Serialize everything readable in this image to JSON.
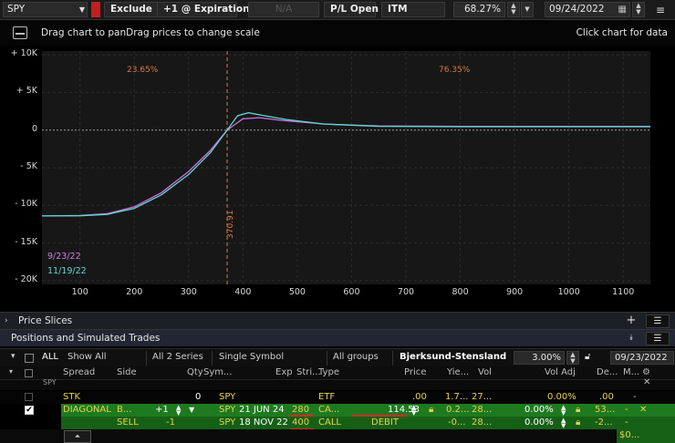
{
  "toolbar": {
    "symbol": "SPY",
    "exclude_label": "Exclude",
    "expiration_label": "+1 @ Expiration",
    "na_value": "N/A",
    "pl_label": "P/L Open",
    "itm_label": "ITM",
    "pct_value": "68.27%",
    "date_value": "09/24/2022"
  },
  "chart_header": {
    "hint": "Drag chart to panDrag prices to change scale",
    "click_hint": "Click chart for data"
  },
  "chart_data": {
    "type": "line",
    "y_ticks": [
      "+ 10K",
      "+ 5K",
      "0",
      "- 5K",
      "- 10K",
      "- 15K",
      "- 20K"
    ],
    "y_values": [
      10000,
      5000,
      0,
      -5000,
      -10000,
      -15000,
      -20000
    ],
    "x_ticks": [
      "100",
      "200",
      "300",
      "400",
      "500",
      "600",
      "700",
      "800",
      "900",
      "1000",
      "1100"
    ],
    "x_values": [
      100,
      200,
      300,
      400,
      500,
      600,
      700,
      800,
      900,
      1000,
      1100
    ],
    "xlim": [
      30,
      1150
    ],
    "ylim": [
      -20500,
      10500
    ],
    "vline_price": "370.91",
    "vline_x": 370.91,
    "prob_left": "23.65%",
    "prob_right": "76.35%",
    "series": [
      {
        "name": "9/23/22",
        "color": "#c86fe0",
        "x": [
          30,
          100,
          150,
          200,
          250,
          300,
          340,
          370.91,
          400,
          430,
          470,
          550,
          650,
          800,
          1000,
          1150
        ],
        "y": [
          -11400,
          -11350,
          -11100,
          -10200,
          -8300,
          -5500,
          -2700,
          0,
          1500,
          1650,
          1300,
          800,
          550,
          500,
          500,
          500
        ]
      },
      {
        "name": "11/19/22",
        "color": "#5fd7d0",
        "x": [
          30,
          100,
          150,
          200,
          250,
          300,
          340,
          370.91,
          390,
          410,
          440,
          480,
          550,
          650,
          800,
          1000,
          1150
        ],
        "y": [
          -11400,
          -11380,
          -11200,
          -10400,
          -8600,
          -5900,
          -3000,
          0,
          1900,
          2300,
          1900,
          1400,
          800,
          500,
          450,
          450,
          450
        ]
      }
    ]
  },
  "sections": {
    "price_slices": "Price Slices",
    "positions": "Positions and Simulated Trades"
  },
  "positions_toolbar": {
    "all": "ALL",
    "show_all": "Show All",
    "series": "All 2 Series",
    "symbol_mode": "Single Symbol",
    "groups": "All groups",
    "model": "Bjerksund-Stensland",
    "rate": "3.00%",
    "date": "09/23/2022"
  },
  "table": {
    "headers": [
      "Spread",
      "Side",
      "Qty",
      "Sym...",
      "Exp",
      "Stri...",
      "Type",
      "Price",
      "Yie...",
      "Vol",
      "Vol Adj",
      "De...",
      "M..."
    ],
    "group_symbol": "SPY",
    "rows": [
      {
        "spread": "STK",
        "side": "",
        "qty": "0",
        "sym": "SPY",
        "exp": "",
        "strike": "",
        "type": "ETF",
        "price": ".00",
        "yield": "1.7...",
        "vol": "27...",
        "voladj": "0.00%",
        "delta": ".00",
        "m": "-"
      },
      {
        "spread": "DIAGONAL",
        "side": "B...",
        "qty": "+1",
        "sym": "SPY",
        "exp": "21 JUN 24",
        "strike": "280",
        "type": "CA...",
        "price": "114.53",
        "yield": "0.2...",
        "vol": "28...",
        "voladj": "0.00%",
        "delta": "53...",
        "m": "-"
      },
      {
        "spread": "",
        "side": "SELL",
        "qty": "-1",
        "sym": "SPY",
        "exp": "18 NOV 22",
        "strike": "400",
        "type": "CALL",
        "price": "DEBIT",
        "yield": "-0...",
        "vol": "28...",
        "voladj": "0.00%",
        "delta": "-2...",
        "m": "-"
      }
    ],
    "footer_value": "$0..."
  }
}
